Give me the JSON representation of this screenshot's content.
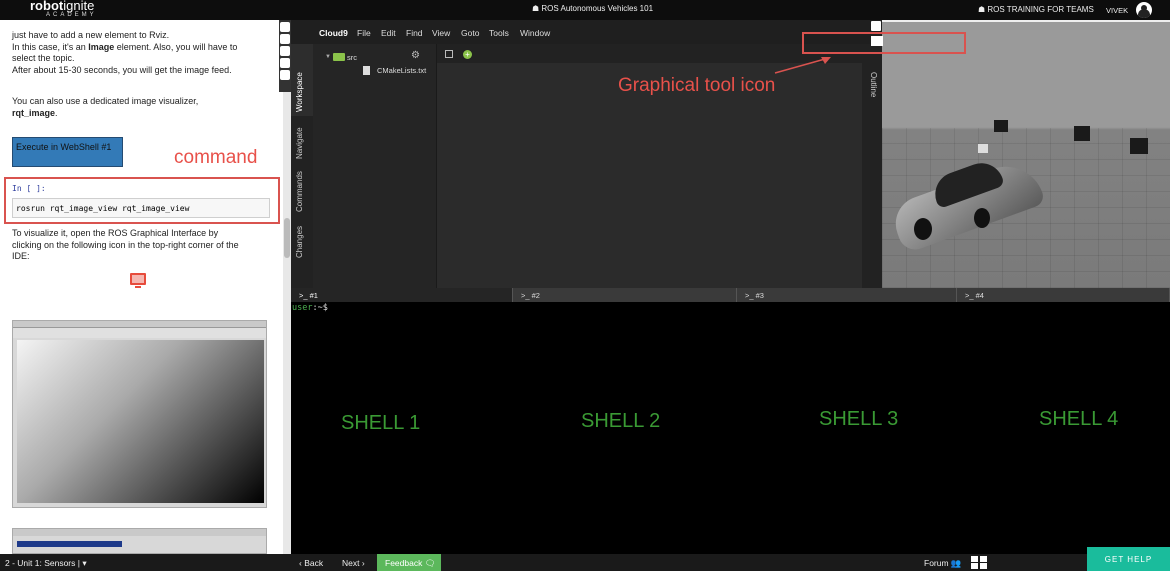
{
  "topbar": {
    "logo_bold": "robot",
    "logo_light": "ignite",
    "logo_sub": "ACADEMY",
    "course_title": "☗ ROS Autonomous Vehicles 101",
    "training": "☗ ROS TRAINING FOR TEAMS",
    "user": "VIVEK"
  },
  "notebook": {
    "para1_line1": "just have to add a new element to Rviz.",
    "para1_line2": "In this case, it's an ",
    "para1_bold": "Image",
    "para1_line2b": " element. Also, you will have to",
    "para1_line3": "select the topic.",
    "para1_line4": "After about 15-30 seconds, you will get the image feed.",
    "para2_line1": "You can also use a dedicated image visualizer,",
    "para2_bold": "rqt_image",
    "para2_dot": ".",
    "exec_button": "Execute in WebShell #1",
    "cell_prompt": "In [ ]:",
    "cell_code": "rosrun rqt_image_view rqt_image_view",
    "para3_line1": "To visualize it, open the ROS Graphical Interface by",
    "para3_line2": "clicking on the following icon in the top-right corner of the",
    "para3_line3": "IDE:"
  },
  "annotations": {
    "command": "command",
    "graphical_tool": "Graphical tool icon",
    "accent": "#e8514a"
  },
  "ide": {
    "menu": [
      "Cloud9",
      "File",
      "Edit",
      "Find",
      "View",
      "Goto",
      "Tools",
      "Window"
    ],
    "vertical_tabs": [
      "Workspace",
      "Navigate",
      "Commands",
      "Changes"
    ],
    "outline_tab": "Outline",
    "tree_folder": "src",
    "tree_file": "CMakeLists.txt"
  },
  "shells": {
    "tabs": [
      ">_ #1",
      ">_ #2",
      ">_ #3",
      ">_ #4"
    ],
    "prompt_user": "user",
    "prompt_rest": ":~$",
    "labels": [
      "SHELL 1",
      "SHELL 2",
      "SHELL 3",
      "SHELL 4"
    ]
  },
  "bottombar": {
    "unit": "2 - Unit 1: Sensors | ▾",
    "back": "‹ Back",
    "next": "Next ›",
    "feedback": "Feedback 🗨",
    "forum": "Forum 👥",
    "get_help": "GET HELP"
  }
}
